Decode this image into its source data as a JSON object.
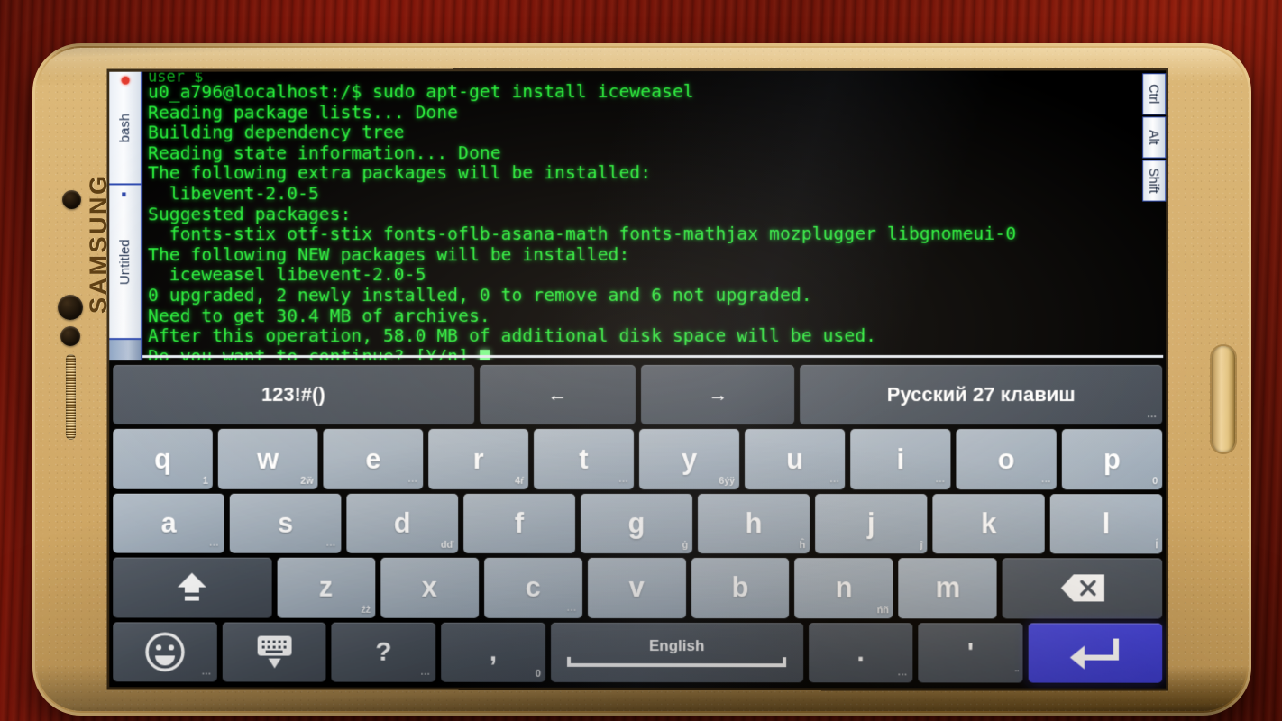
{
  "device": {
    "brand": "SAMSUNG",
    "body_color": "#d4ad6c",
    "hardware": {
      "sensor_dot": "sensor-dot",
      "front_camera": "front-camera-icon",
      "proximity_sensor": "proximity-sensor-icon",
      "earpiece": "earpiece-grille",
      "power_button": "power-button"
    }
  },
  "background": {
    "surface": "dark red wooden table",
    "color": "#7a1509"
  },
  "terminal": {
    "clipped_top_line": "user $",
    "tabs": [
      {
        "label": "bash",
        "active": true,
        "close_marker": "close-dot"
      },
      {
        "label": "Untitled",
        "active": false,
        "close_marker": "tab-mark"
      }
    ],
    "modifier_keys": [
      "Ctrl",
      "Alt",
      "Shift"
    ],
    "text_color": "#27f03a",
    "background_color": "#000000",
    "lines": [
      "u0_a796@localhost:/$ sudo apt-get install iceweasel",
      "Reading package lists... Done",
      "Building dependency tree",
      "Reading state information... Done",
      "The following extra packages will be installed:",
      "  libevent-2.0-5",
      "Suggested packages:",
      "  fonts-stix otf-stix fonts-oflb-asana-math fonts-mathjax mozplugger libgnomeui-0",
      "The following NEW packages will be installed:",
      "  iceweasel libevent-2.0-5",
      "0 upgraded, 2 newly installed, 0 to remove and 6 not upgraded.",
      "Need to get 30.4 MB of archives.",
      "After this operation, 58.0 MB of additional disk space will be used.",
      "Do you want to continue? [Y/n] "
    ]
  },
  "keyboard": {
    "accent_color": "#4a4ae4",
    "key_color": "#a7b3bf",
    "dark_key_color": "#4c545e",
    "rows": [
      {
        "name": "function-row",
        "keys": [
          {
            "name": "symbols-key",
            "label": "123!#()",
            "style": "dark",
            "flex": 404,
            "hint": ""
          },
          {
            "name": "arrow-left-key",
            "label": "←",
            "style": "dark",
            "flex": 175,
            "hint": ""
          },
          {
            "name": "arrow-right-key",
            "label": "→",
            "style": "dark",
            "flex": 171,
            "hint": ""
          },
          {
            "name": "language-key",
            "label": "Русский 27 клавиш",
            "style": "dark",
            "flex": 403,
            "hint": "..."
          }
        ]
      },
      {
        "name": "qwerty-row",
        "keys": [
          {
            "name": "key-q",
            "label": "q",
            "style": "letter",
            "flex": 1,
            "hint": "1"
          },
          {
            "name": "key-w",
            "label": "w",
            "style": "letter",
            "flex": 1,
            "hint": "2ẅ"
          },
          {
            "name": "key-e",
            "label": "e",
            "style": "letter",
            "flex": 1,
            "hint": "..."
          },
          {
            "name": "key-r",
            "label": "r",
            "style": "letter",
            "flex": 1,
            "hint": "4ŕ"
          },
          {
            "name": "key-t",
            "label": "t",
            "style": "letter",
            "flex": 1,
            "hint": "..."
          },
          {
            "name": "key-y",
            "label": "y",
            "style": "letter",
            "flex": 1,
            "hint": "6ýÿ"
          },
          {
            "name": "key-u",
            "label": "u",
            "style": "letter",
            "flex": 1,
            "hint": "..."
          },
          {
            "name": "key-i",
            "label": "i",
            "style": "letter",
            "flex": 1,
            "hint": "..."
          },
          {
            "name": "key-o",
            "label": "o",
            "style": "letter",
            "flex": 1,
            "hint": "..."
          },
          {
            "name": "key-p",
            "label": "p",
            "style": "letter",
            "flex": 1,
            "hint": "0"
          }
        ]
      },
      {
        "name": "home-row",
        "keys": [
          {
            "name": "key-a",
            "label": "a",
            "style": "letter",
            "flex": 1,
            "hint": "..."
          },
          {
            "name": "key-s",
            "label": "s",
            "style": "letter",
            "flex": 1,
            "hint": "..."
          },
          {
            "name": "key-d",
            "label": "d",
            "style": "letter",
            "flex": 1,
            "hint": "dď"
          },
          {
            "name": "key-f",
            "label": "f",
            "style": "letter",
            "flex": 1,
            "hint": ""
          },
          {
            "name": "key-g",
            "label": "g",
            "style": "letter",
            "flex": 1,
            "hint": "ġ"
          },
          {
            "name": "key-h",
            "label": "h",
            "style": "letter",
            "flex": 1,
            "hint": "ĥ"
          },
          {
            "name": "key-j",
            "label": "j",
            "style": "letter",
            "flex": 1,
            "hint": "ĵ"
          },
          {
            "name": "key-k",
            "label": "k",
            "style": "letter",
            "flex": 1,
            "hint": ""
          },
          {
            "name": "key-l",
            "label": "l",
            "style": "letter",
            "flex": 1,
            "hint": "ĺ"
          }
        ]
      },
      {
        "name": "zxcvb-row",
        "keys": [
          {
            "name": "shift-key",
            "label": "",
            "style": "dark",
            "flex": 1.62,
            "hint": "",
            "icon": "shift-up-icon"
          },
          {
            "name": "key-z",
            "label": "z",
            "style": "letter",
            "flex": 1,
            "hint": "źż"
          },
          {
            "name": "key-x",
            "label": "x",
            "style": "letter",
            "flex": 1,
            "hint": ""
          },
          {
            "name": "key-c",
            "label": "c",
            "style": "letter",
            "flex": 1,
            "hint": "..."
          },
          {
            "name": "key-v",
            "label": "v",
            "style": "letter",
            "flex": 1,
            "hint": ""
          },
          {
            "name": "key-b",
            "label": "b",
            "style": "letter",
            "flex": 1,
            "hint": ""
          },
          {
            "name": "key-n",
            "label": "n",
            "style": "letter",
            "flex": 1,
            "hint": "ńñ"
          },
          {
            "name": "key-m",
            "label": "m",
            "style": "letter",
            "flex": 1,
            "hint": ""
          },
          {
            "name": "backspace-key",
            "label": "",
            "style": "dark",
            "flex": 1.62,
            "hint": "",
            "icon": "backspace-icon"
          }
        ]
      },
      {
        "name": "bottom-row",
        "keys": [
          {
            "name": "emoji-key",
            "label": "",
            "style": "dark",
            "flex": 1.0,
            "hint": "...",
            "icon": "emoji-smiley-icon"
          },
          {
            "name": "hide-keyboard-key",
            "label": "",
            "style": "dark",
            "flex": 1.0,
            "hint": "",
            "icon": "keyboard-hide-icon"
          },
          {
            "name": "question-key",
            "label": "?",
            "style": "dark",
            "flex": 1.0,
            "hint": "..."
          },
          {
            "name": "comma-key",
            "label": ",",
            "style": "dark",
            "flex": 1.0,
            "hint": "0"
          },
          {
            "name": "space-key",
            "label": "English",
            "style": "space",
            "flex": 2.42,
            "hint": ""
          },
          {
            "name": "period-key",
            "label": ".",
            "style": "dark",
            "flex": 1.0,
            "hint": "..."
          },
          {
            "name": "apostrophe-key",
            "label": "'",
            "style": "dark",
            "flex": 1.0,
            "hint": "¨"
          },
          {
            "name": "enter-key",
            "label": "",
            "style": "accent",
            "flex": 1.28,
            "hint": "",
            "icon": "enter-arrow-icon"
          }
        ]
      }
    ]
  }
}
